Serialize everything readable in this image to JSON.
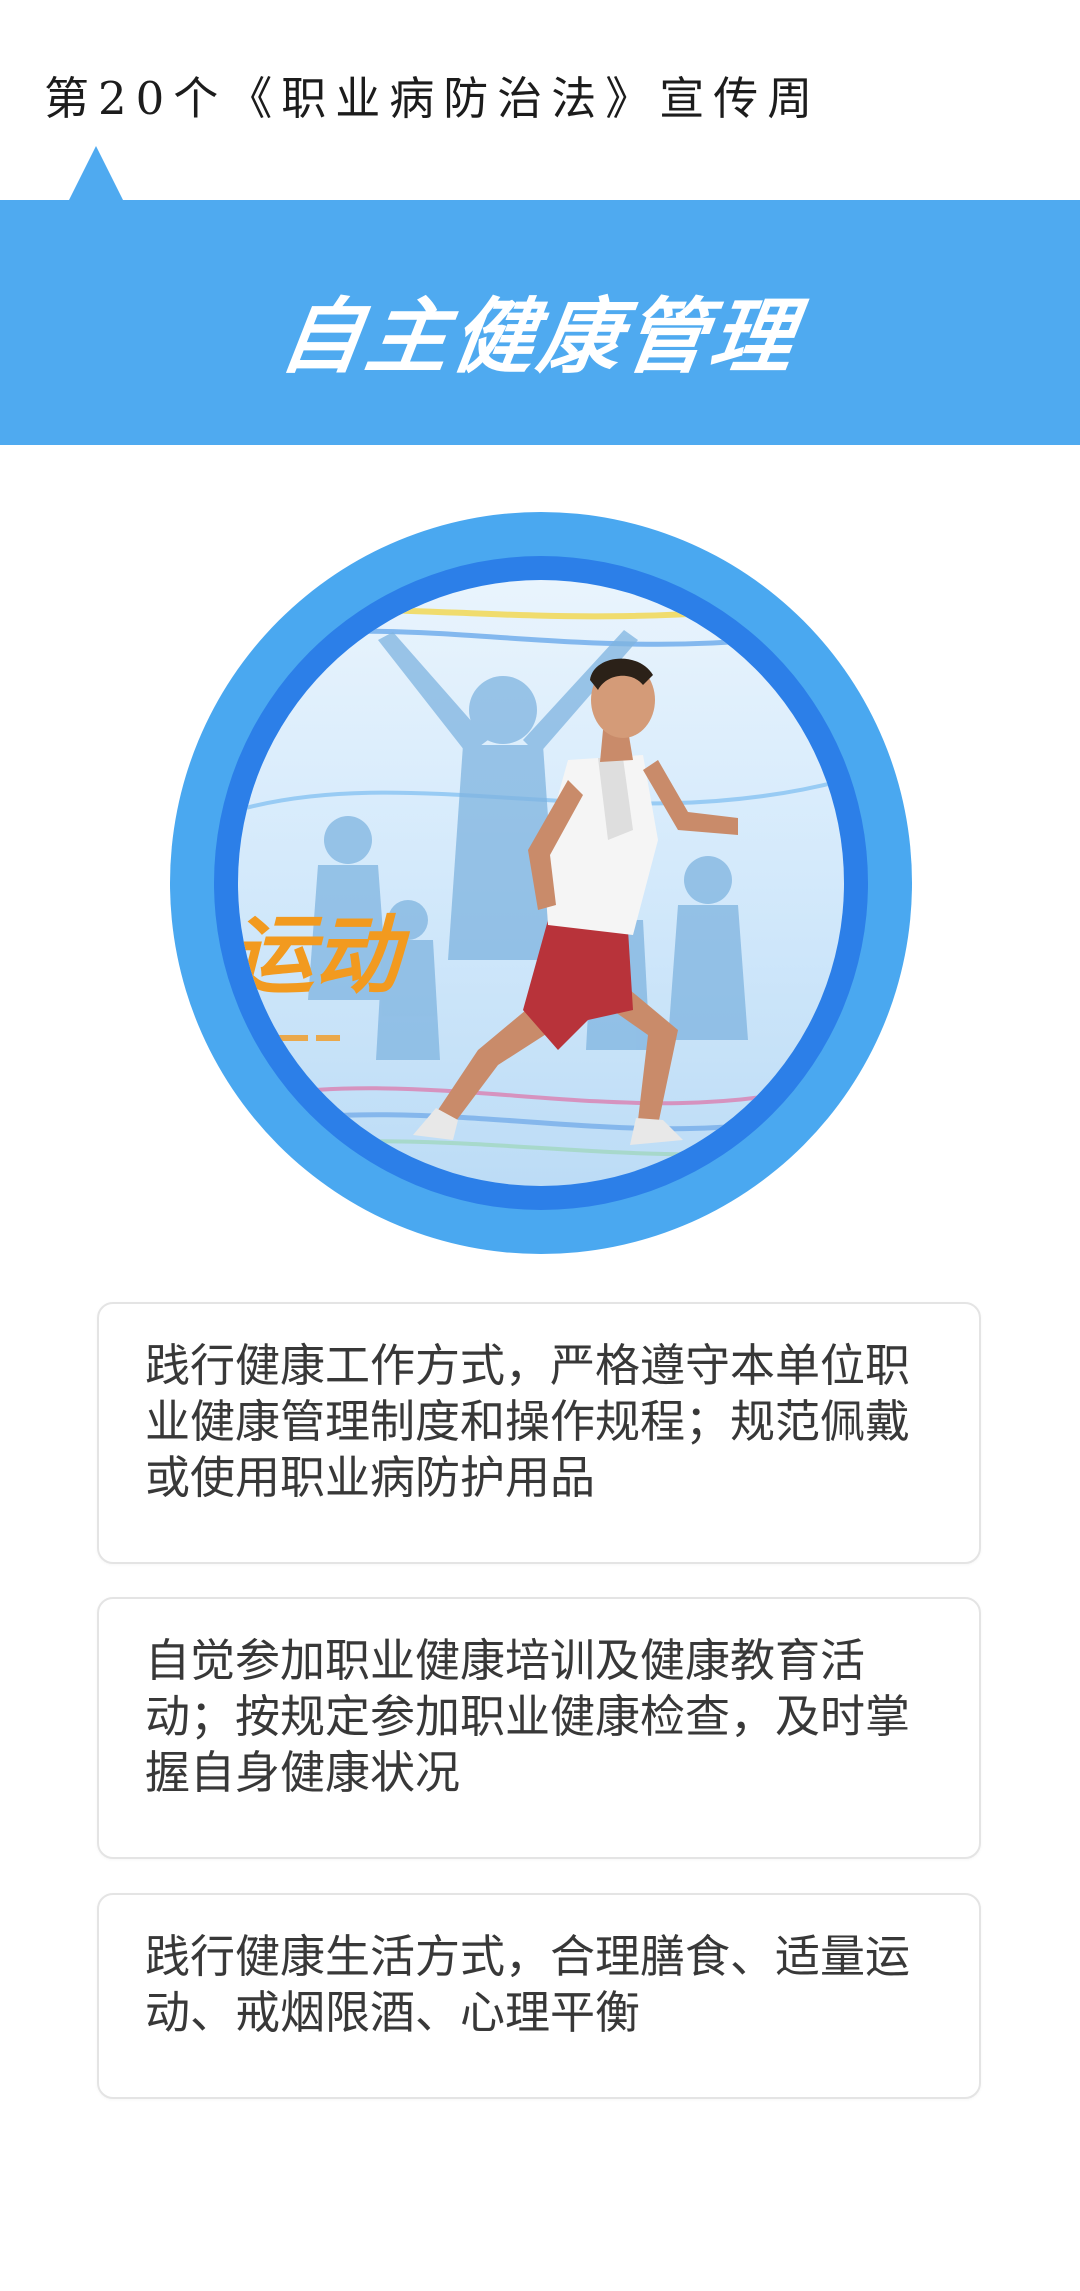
{
  "header": {
    "subtitle": "第20个《职业病防治法》宣传周",
    "banner_title": "自主健康管理"
  },
  "illustration": {
    "description_icon": "runner-icon",
    "caption_text": "运动"
  },
  "colors": {
    "banner": "#4faaf0",
    "ring_outer": "#4aa8f0",
    "ring_inner": "#2c7fe8",
    "card_border": "#e4e4e4",
    "text": "#383838"
  },
  "cards": [
    {
      "text": "践行健康工作方式，严格遵守本单位职业健康管理制度和操作规程；规范佩戴或使用职业病防护用品"
    },
    {
      "text": "自觉参加职业健康培训及健康教育活动；按规定参加职业健康检查，及时掌握自身健康状况"
    },
    {
      "text": "践行健康生活方式，合理膳食、适量运动、戒烟限酒、心理平衡"
    }
  ]
}
